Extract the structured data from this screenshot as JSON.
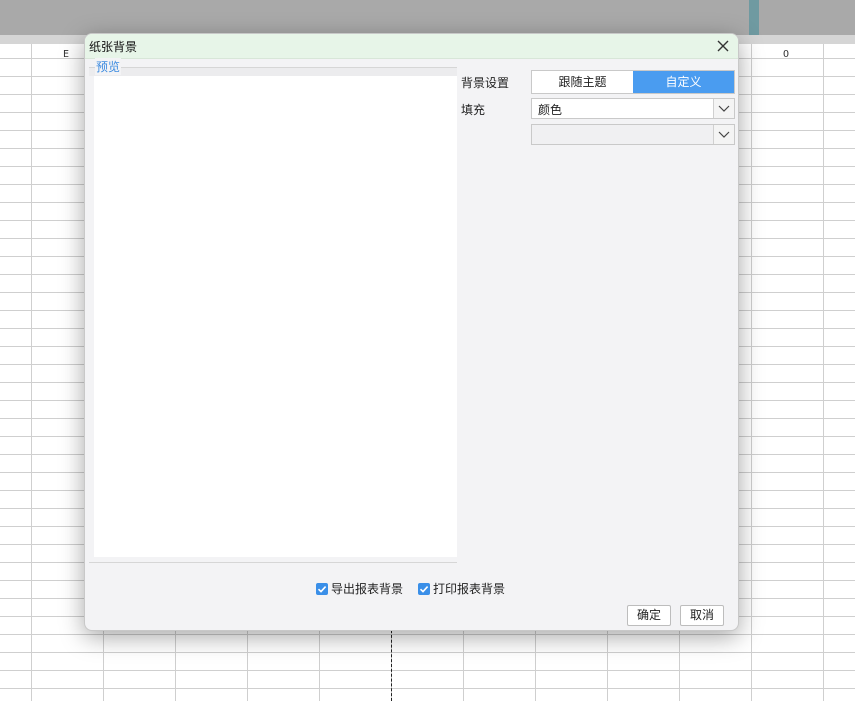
{
  "spreadsheet": {
    "col_header_left": "E",
    "col_header_right": "O"
  },
  "dialog": {
    "title": "纸张背景",
    "preview_label": "预览",
    "background_setting_label": "背景设置",
    "segment_options": [
      "跟随主题",
      "自定义"
    ],
    "segment_selected": "自定义",
    "fill_label": "填充",
    "fill_value": "颜色",
    "color_value": "",
    "export_checkbox": {
      "label": "导出报表背景",
      "checked": true
    },
    "print_checkbox": {
      "label": "打印报表背景",
      "checked": true
    },
    "ok_label": "确定",
    "cancel_label": "取消"
  },
  "colors": {
    "accent": "#4a9cf0",
    "titlebar": "#e7f5e8",
    "preview_label": "#3c8be0"
  }
}
